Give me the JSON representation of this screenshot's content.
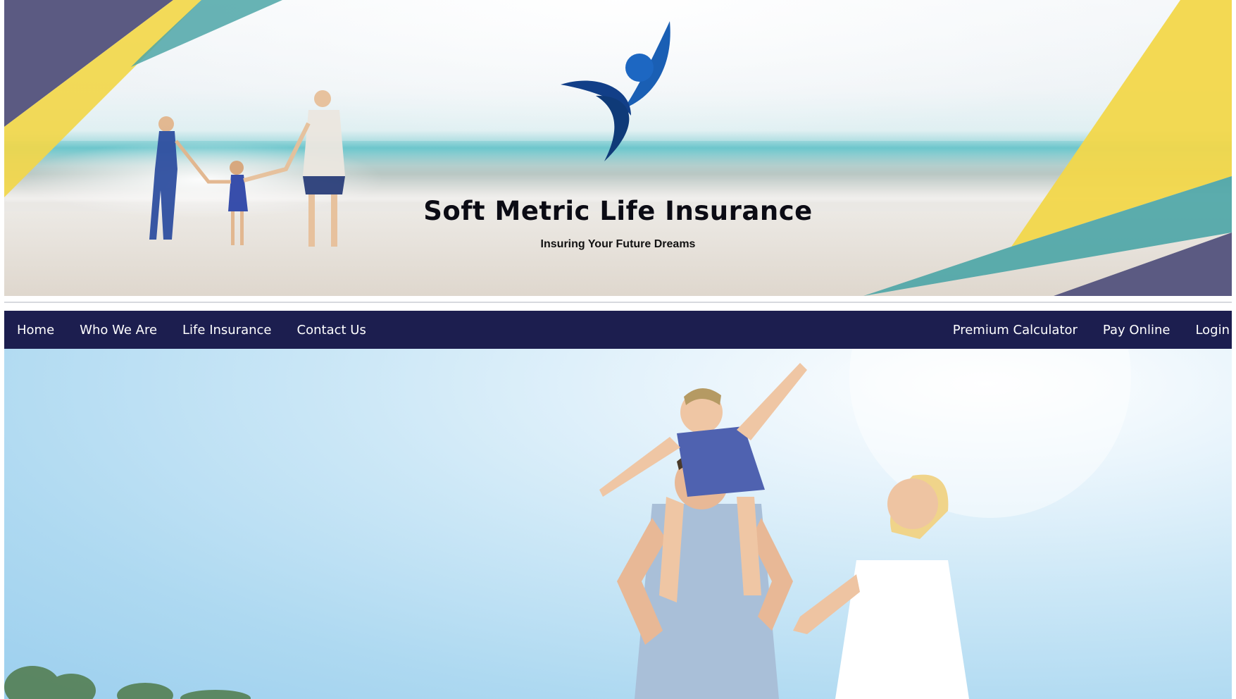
{
  "header": {
    "title": "Soft Metric Life Insurance",
    "tagline": "Insuring Your Future Dreams",
    "logo_icon": "person-swoosh-logo",
    "colors": {
      "navy": "#1c1e4f",
      "yellow": "#f2d74a",
      "teal": "#4ea6a7",
      "purple": "#5b5a82",
      "logo_blue": "#1a5fb4"
    }
  },
  "nav": {
    "left": [
      {
        "label": "Home"
      },
      {
        "label": "Who We Are"
      },
      {
        "label": "Life Insurance"
      },
      {
        "label": "Contact Us"
      }
    ],
    "right": [
      {
        "label": "Premium Calculator"
      },
      {
        "label": "Pay Online"
      },
      {
        "label": "Login"
      }
    ]
  }
}
